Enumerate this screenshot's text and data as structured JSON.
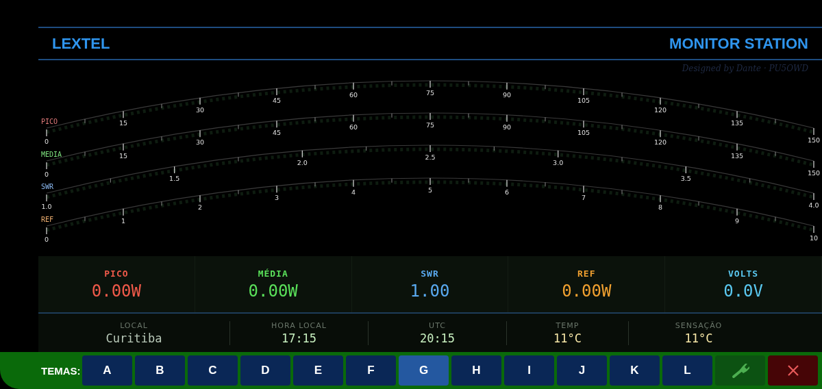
{
  "header": {
    "brand": "LEXTEL",
    "title": "MONITOR STATION",
    "credit": "Designed by Dante · PU5OWD"
  },
  "meters": [
    {
      "label": "PICO",
      "color": "#e07a7a",
      "ticks": [
        "0",
        "15",
        "30",
        "45",
        "60",
        "75",
        "90",
        "105",
        "120",
        "135",
        "150"
      ]
    },
    {
      "label": "MEDIA",
      "color": "#7ee07e",
      "ticks": [
        "0",
        "15",
        "30",
        "45",
        "60",
        "75",
        "90",
        "105",
        "120",
        "135",
        "150"
      ]
    },
    {
      "label": "SWR",
      "color": "#8ab8f0",
      "ticks": [
        "1.0",
        "1.5",
        "2.0",
        "2.5",
        "3.0",
        "3.5",
        "4.0"
      ]
    },
    {
      "label": "REF",
      "color": "#f0b070",
      "ticks": [
        "0",
        "1",
        "2",
        "3",
        "4",
        "5",
        "6",
        "7",
        "8",
        "9",
        "10"
      ]
    }
  ],
  "readings": [
    {
      "label": "PICO",
      "value": "0.00W",
      "color": "#f05a4a"
    },
    {
      "label": "MÉDIA",
      "value": "0.00W",
      "color": "#5ae05a"
    },
    {
      "label": "SWR",
      "value": "1.00",
      "color": "#5aaaf0"
    },
    {
      "label": "REF",
      "value": "0.00W",
      "color": "#f0a030"
    },
    {
      "label": "VOLTS",
      "value": "0.0V",
      "color": "#5ac8f0"
    }
  ],
  "info": [
    {
      "label": "LOCAL",
      "value": "Curitiba",
      "color": "#b8c8b8"
    },
    {
      "label": "HORA LOCAL",
      "value": "17:15",
      "color": "#c8f0c0"
    },
    {
      "label": "UTC",
      "value": "20:15",
      "color": "#c8f0c0"
    },
    {
      "label": "TEMP",
      "value": "11°C",
      "color": "#f8e8a8"
    },
    {
      "label": "SENSAÇÃO",
      "value": "11°C",
      "color": "#f8e8a8"
    }
  ],
  "themes": {
    "label": "TEMAS:",
    "options": [
      {
        "label": "A",
        "selected": false
      },
      {
        "label": "B",
        "selected": false
      },
      {
        "label": "C",
        "selected": false
      },
      {
        "label": "D",
        "selected": false
      },
      {
        "label": "E",
        "selected": false
      },
      {
        "label": "F",
        "selected": false
      },
      {
        "label": "G",
        "selected": true
      },
      {
        "label": "H",
        "selected": false
      },
      {
        "label": "I",
        "selected": false
      },
      {
        "label": "J",
        "selected": false
      },
      {
        "label": "K",
        "selected": false
      },
      {
        "label": "L",
        "selected": false
      }
    ]
  },
  "actions": [
    {
      "kind": "settings"
    },
    {
      "kind": "close"
    }
  ]
}
